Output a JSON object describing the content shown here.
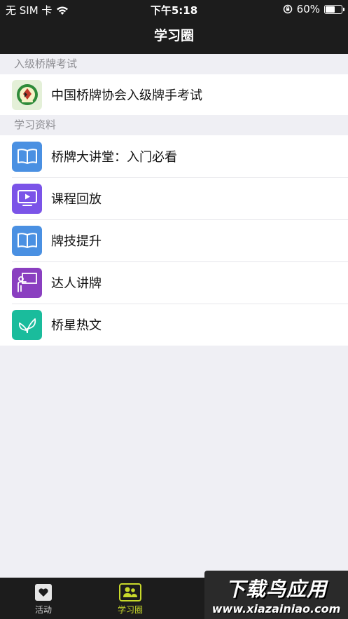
{
  "status_bar": {
    "carrier": "无 SIM 卡",
    "time": "下午5:18",
    "battery_percent": "60%",
    "battery_level": 0.6
  },
  "nav": {
    "title": "学习圈"
  },
  "sections": [
    {
      "header": "入级桥牌考试",
      "items": [
        {
          "label": "中国桥牌协会入级牌手考试",
          "icon": "bridge-association-logo-icon"
        }
      ]
    },
    {
      "header": "学习资料",
      "items": [
        {
          "label": "桥牌大讲堂：入门必看",
          "icon": "book-icon",
          "color": "#4a90e2"
        },
        {
          "label": "课程回放",
          "icon": "video-play-icon",
          "color": "#7b54e8"
        },
        {
          "label": "牌技提升",
          "icon": "book-icon",
          "color": "#4a90e2"
        },
        {
          "label": "达人讲牌",
          "icon": "teacher-board-icon",
          "color": "#8a3fc0"
        },
        {
          "label": "桥星热文",
          "icon": "leaf-icon",
          "color": "#1abc9c"
        }
      ]
    }
  ],
  "tabs": [
    {
      "label": "活动",
      "icon": "heart-icon"
    },
    {
      "label": "学习圈",
      "icon": "people-icon",
      "active": true
    }
  ],
  "watermark": {
    "title": "下载鸟应用",
    "url": "www.xiazainiao.com"
  },
  "colors": {
    "accent": "#c8d92b",
    "bar_bg": "#1c1c1c"
  }
}
